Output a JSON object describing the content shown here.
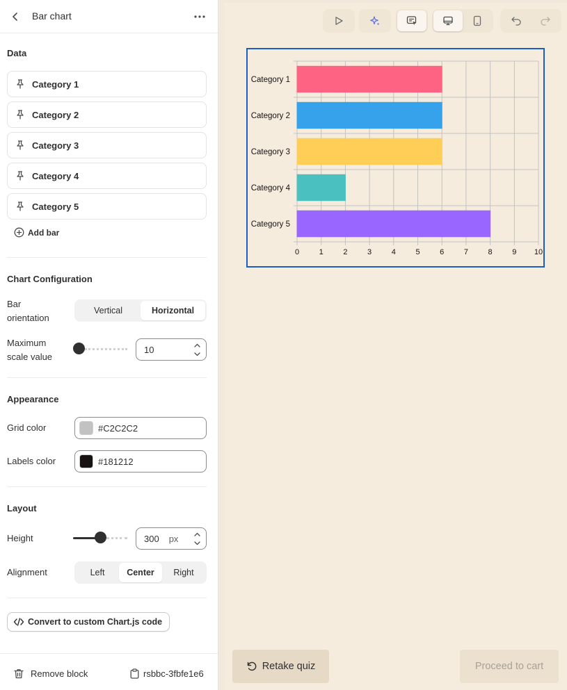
{
  "header": {
    "title": "Bar chart"
  },
  "data_section": {
    "title": "Data",
    "items": [
      {
        "label": "Category 1"
      },
      {
        "label": "Category 2"
      },
      {
        "label": "Category 3"
      },
      {
        "label": "Category 4"
      },
      {
        "label": "Category 5"
      }
    ],
    "add_label": "Add bar"
  },
  "config": {
    "title": "Chart Configuration",
    "orientation_label": "Bar orientation",
    "orientation_options": [
      "Vertical",
      "Horizontal"
    ],
    "orientation_selected": "Horizontal",
    "max_label": "Maximum scale value",
    "max_value": "10",
    "max_slider_fraction": 0.0
  },
  "appearance": {
    "title": "Appearance",
    "grid_label": "Grid color",
    "grid_value": "#C2C2C2",
    "labels_label": "Labels color",
    "labels_value": "#181212"
  },
  "layout": {
    "title": "Layout",
    "height_label": "Height",
    "height_value": "300",
    "height_unit": "px",
    "height_slider_fraction": 0.5,
    "alignment_label": "Alignment",
    "alignment_options": [
      "Left",
      "Center",
      "Right"
    ],
    "alignment_selected": "Center"
  },
  "convert_label": "Convert to custom Chart.js code",
  "footer": {
    "remove_label": "Remove block",
    "block_id": "rsbbc-3fbfe1e6"
  },
  "toolbar": {
    "icons": [
      "play-icon",
      "sparkle-icon",
      "inspect-icon",
      "desktop-icon",
      "mobile-icon",
      "undo-icon",
      "redo-icon"
    ]
  },
  "actions": {
    "retake_label": "Retake quiz",
    "proceed_label": "Proceed to cart"
  },
  "colors": {
    "accent_frame": "#1c5cc7",
    "canvas_bg": "#f5ecdd"
  },
  "chart_data": {
    "type": "bar",
    "orientation": "horizontal",
    "categories": [
      "Category 1",
      "Category 2",
      "Category 3",
      "Category 4",
      "Category 5"
    ],
    "values": [
      6,
      6,
      6,
      2,
      8
    ],
    "colors": [
      "#ff6384",
      "#36a2eb",
      "#ffce56",
      "#4bc0c0",
      "#9966ff"
    ],
    "xlim": [
      0,
      10
    ],
    "xticks": [
      "0",
      "1",
      "2",
      "3",
      "4",
      "5",
      "6",
      "7",
      "8",
      "9",
      "10"
    ],
    "grid": true,
    "grid_color": "#C2C2C2",
    "label_color": "#181212"
  }
}
